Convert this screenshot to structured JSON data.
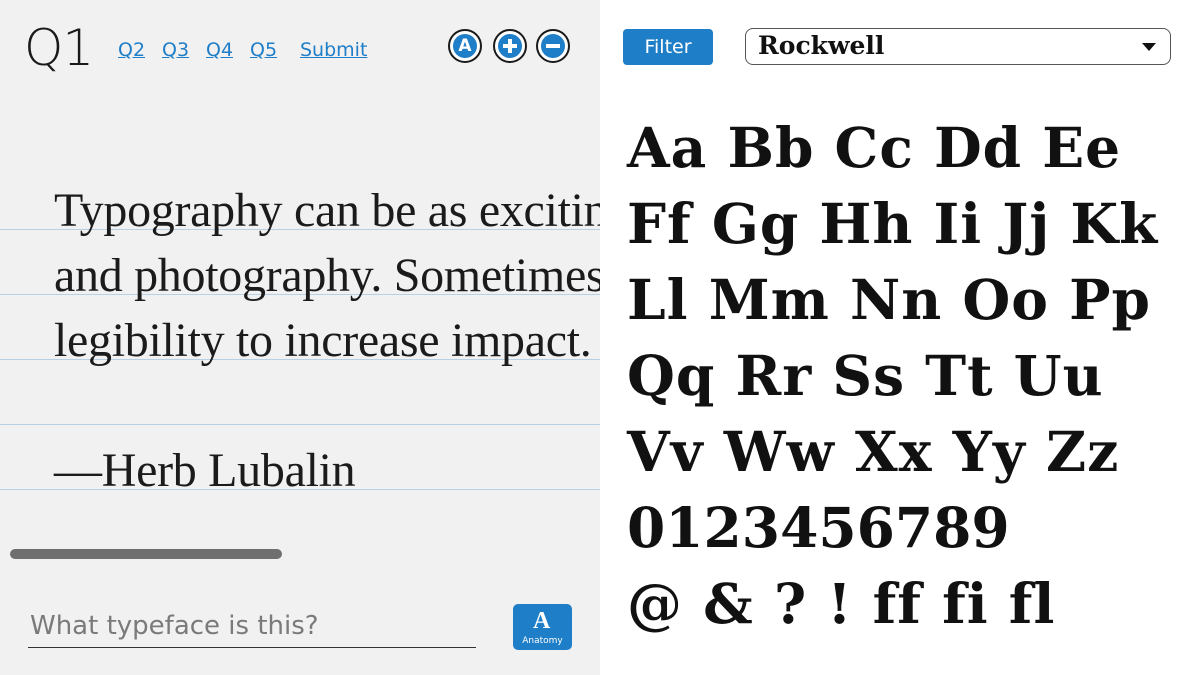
{
  "question": {
    "current": "Q1",
    "nav": [
      "Q2",
      "Q3",
      "Q4",
      "Q5"
    ],
    "submit_label": "Submit"
  },
  "controls": {
    "font_button_label": "A"
  },
  "quote": {
    "lines": [
      "Typography can be as exciting as illustration",
      "and photography. Sometimes you have to sacrifice",
      "legibility to increase impact."
    ],
    "attribution": "—Herb Lubalin"
  },
  "answer": {
    "placeholder": "What typeface is this?",
    "value": ""
  },
  "anatomy": {
    "icon_glyph": "A",
    "label": "Anatomy"
  },
  "filter": {
    "button_label": "Filter",
    "selected_font": "Rockwell"
  },
  "specimen": {
    "lines": [
      "Aa Bb Cc Dd Ee",
      "Ff Gg Hh Ii Jj Kk",
      "Ll Mm Nn Oo Pp",
      "Qq Rr Ss Tt Uu",
      "Vv Ww Xx Yy Zz",
      "0123456789",
      "@ & ? ! ff fi fl"
    ]
  },
  "colors": {
    "accent": "#1f7ec8",
    "left_background": "#f1f1f1",
    "rule": "#b9cfe3"
  }
}
